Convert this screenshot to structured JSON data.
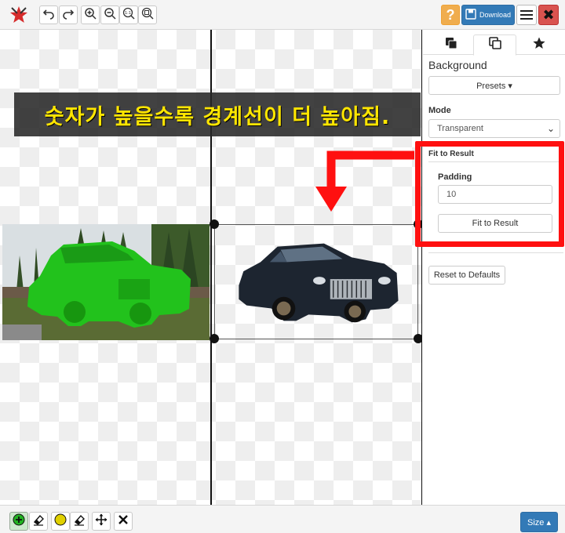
{
  "toolbar": {
    "logo_icon": "app-logo-icon",
    "tools": [
      "undo-icon",
      "redo-icon",
      "zoom-in-icon",
      "zoom-out-icon",
      "zoom-actual-icon",
      "zoom-fit-icon"
    ],
    "help_label": "?",
    "download_label": "Download",
    "close_label": "✖"
  },
  "caption": {
    "text": "숫자가 높을수록 경계선이 더 높아짐.",
    "color": "#ffe600"
  },
  "panel": {
    "tabs": [
      "layers-icon",
      "copy-icon",
      "star-icon"
    ],
    "active_tab": 1,
    "background_title": "Background",
    "presets_label": "Presets ▾",
    "mode_label": "Mode",
    "mode_value": "Transparent",
    "fit_header": "Fit to Result",
    "padding_label": "Padding",
    "padding_value": "10",
    "fit_button_label": "Fit to Result",
    "reset_label": "Reset to Defaults"
  },
  "annotation": {
    "color": "#ff1010"
  },
  "bottombar": {
    "tools": [
      "keep-brush-icon",
      "keep-eraser-icon",
      "remove-brush-icon",
      "remove-eraser-icon",
      "move-icon",
      "clear-icon"
    ],
    "size_label": "Size ▴"
  },
  "colors": {
    "primary": "#337ab7",
    "warning": "#f0ad4e",
    "danger": "#d9534f",
    "mask_green": "#22c21c"
  }
}
